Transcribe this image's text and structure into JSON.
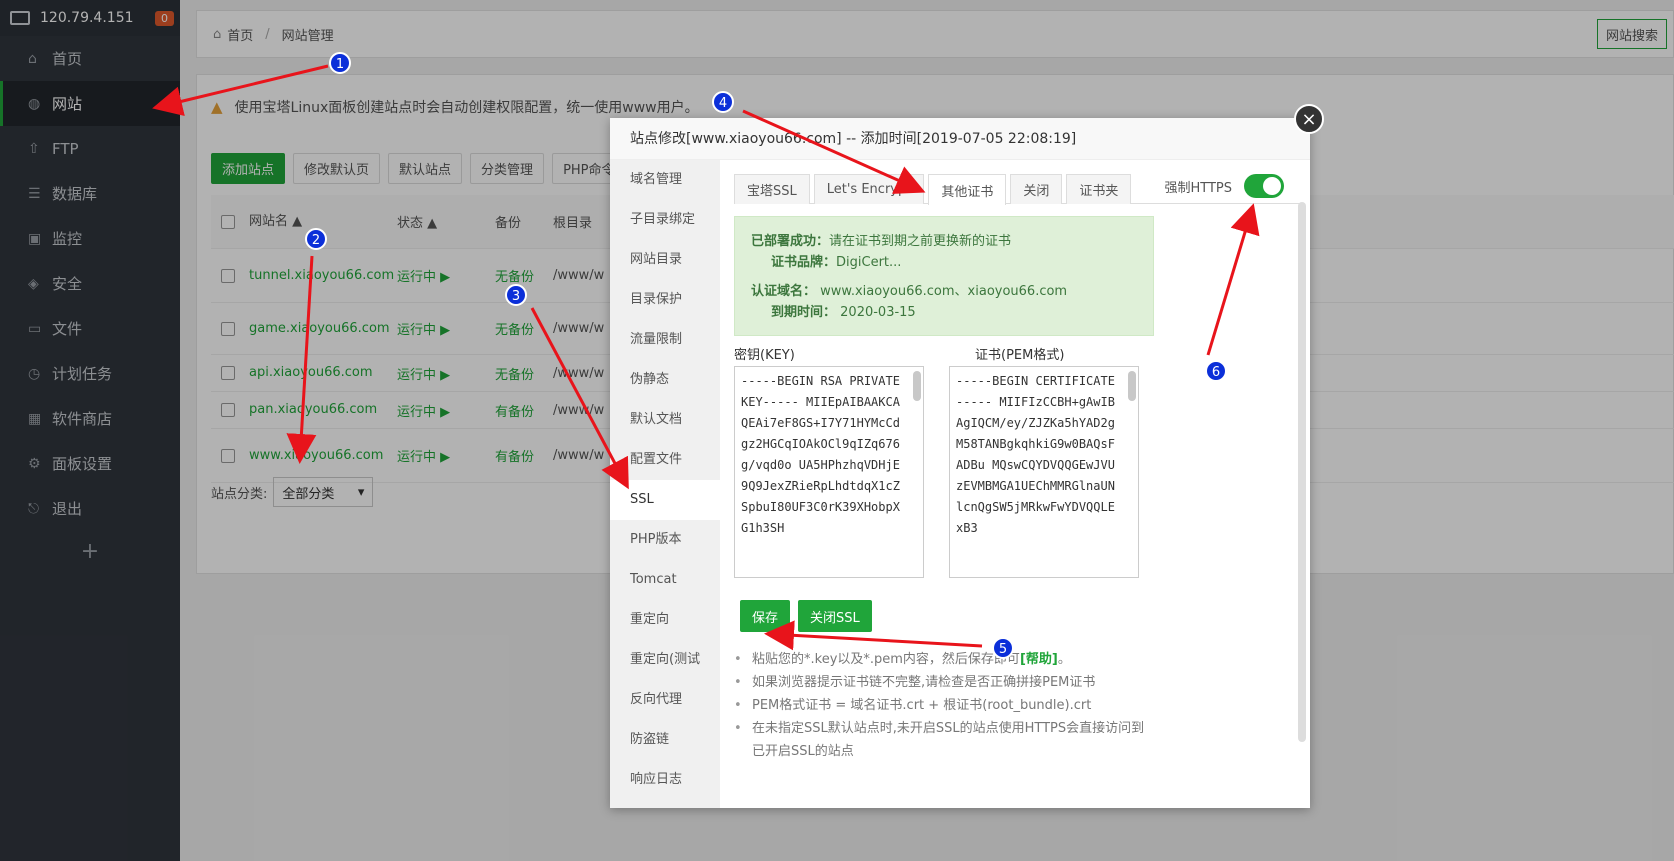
{
  "sidebar": {
    "ip": "120.79.4.151",
    "badge": "0",
    "items": [
      {
        "icon": "home-icon",
        "glyph": "⌂",
        "label": "首页"
      },
      {
        "icon": "globe-icon",
        "glyph": "◍",
        "label": "网站"
      },
      {
        "icon": "ftp-icon",
        "glyph": "⇧",
        "label": "FTP"
      },
      {
        "icon": "database-icon",
        "glyph": "☰",
        "label": "数据库"
      },
      {
        "icon": "monitor-icon",
        "glyph": "▣",
        "label": "监控"
      },
      {
        "icon": "shield-icon",
        "glyph": "◈",
        "label": "安全"
      },
      {
        "icon": "folder-icon",
        "glyph": "▭",
        "label": "文件"
      },
      {
        "icon": "clock-icon",
        "glyph": "◷",
        "label": "计划任务"
      },
      {
        "icon": "grid-icon",
        "glyph": "▦",
        "label": "软件商店"
      },
      {
        "icon": "gear-icon",
        "glyph": "⚙",
        "label": "面板设置"
      },
      {
        "icon": "logout-icon",
        "glyph": "⎋",
        "label": "退出"
      }
    ],
    "add": "+"
  },
  "breadcrumb": {
    "home": "首页",
    "sep": "/",
    "current": "网站管理",
    "search": "网站搜索"
  },
  "notice": "使用宝塔Linux面板创建站点时会自动创建权限配置，统一使用www用户。",
  "toolbar": [
    "添加站点",
    "修改默认页",
    "默认站点",
    "分类管理",
    "PHP命令"
  ],
  "table": {
    "headers": {
      "name": "网站名",
      "status": "状态",
      "backup": "备份",
      "root": "根目录"
    },
    "rows": [
      {
        "name": "tunnel.xiaoyou66.com",
        "status": "运行中 ▶",
        "backup": "无备份",
        "root": "/www/w"
      },
      {
        "name": "game.xiaoyou66.com",
        "status": "运行中 ▶",
        "backup": "无备份",
        "root": "/www/w"
      },
      {
        "name": "api.xiaoyou66.com",
        "status": "运行中 ▶",
        "backup": "无备份",
        "root": "/www/w"
      },
      {
        "name": "pan.xiaoyou66.com",
        "status": "运行中 ▶",
        "backup": "有备份",
        "root": "/www/w"
      },
      {
        "name": "www.xiaoyou66.com",
        "status": "运行中 ▶",
        "backup": "有备份",
        "root": "/www/w"
      }
    ],
    "category_label": "站点分类:",
    "category_value": "全部分类"
  },
  "modal": {
    "title": "站点修改[www.xiaoyou66.com] -- 添加时间[2019-07-05 22:08:19]",
    "close": "×",
    "nav": [
      "域名管理",
      "子目录绑定",
      "网站目录",
      "目录保护",
      "流量限制",
      "伪静态",
      "默认文档",
      "配置文件",
      "SSL",
      "PHP版本",
      "Tomcat",
      "重定向",
      "重定向(测试",
      "反向代理",
      "防盗链",
      "响应日志"
    ],
    "active_nav": 8,
    "tabs": [
      "宝塔SSL",
      "Let's Encrypt",
      "其他证书",
      "关闭",
      "证书夹"
    ],
    "active_tab": 2,
    "force_https": "强制HTTPS",
    "status": {
      "deployed": "已部署成功：",
      "deployed_msg": "请在证书到期之前更换新的证书",
      "brand_label": "证书品牌：",
      "brand": "DigiCert...",
      "domain_label": "认证域名：",
      "domains": "www.xiaoyou66.com、xiaoyou66.com",
      "expire_label": "到期时间：",
      "expire": "2020-03-15"
    },
    "key_label": "密钥(KEY)",
    "cert_label": "证书(PEM格式)",
    "key_text": "-----BEGIN RSA PRIVATE KEY----- MIIEpAIBAAKCAQEAi7eF8GS+I7Y71HYMcCdgz2HGCqIOAkOCl9qIZq676g/vqd0o UA5HPhzhqVDHjE9Q9JexZRieRpLhdtdqX1cZSpbuI80UF3C0rK39XHobpXG1h3SH",
    "cert_text": "-----BEGIN CERTIFICATE----- MIIFIzCCBH+gAwIBAgIQCM/ey/ZJZKa5hYAD2gM58TANBgkqhkiG9w0BAQsFADBu MQswCQYDVQQGEwJVUzEVMBMGA1UEChMMRGlnaUNlcnQgSW5jMRkwFwYDVQQLExB3",
    "save": "保存",
    "close_ssl": "关闭SSL",
    "tips": {
      "t1a": "粘贴您的*.key以及*.pem内容，然后保存即可",
      "t1link": "[帮助]",
      "t1b": "。",
      "t2": "如果浏览器提示证书链不完整,请检查是否正确拼接PEM证书",
      "t3": "PEM格式证书 = 域名证书.crt + 根证书(root_bundle).crt",
      "t4": "在未指定SSL默认站点时,未开启SSL的站点使用HTTPS会直接访问到已开启SSL的站点"
    }
  },
  "annotations": [
    "1",
    "2",
    "3",
    "4",
    "5",
    "6"
  ],
  "colors": {
    "accent": "#20a53a",
    "sidebar": "#30353d",
    "arrow": "#e8141b",
    "badge": "#0b2fd9"
  }
}
